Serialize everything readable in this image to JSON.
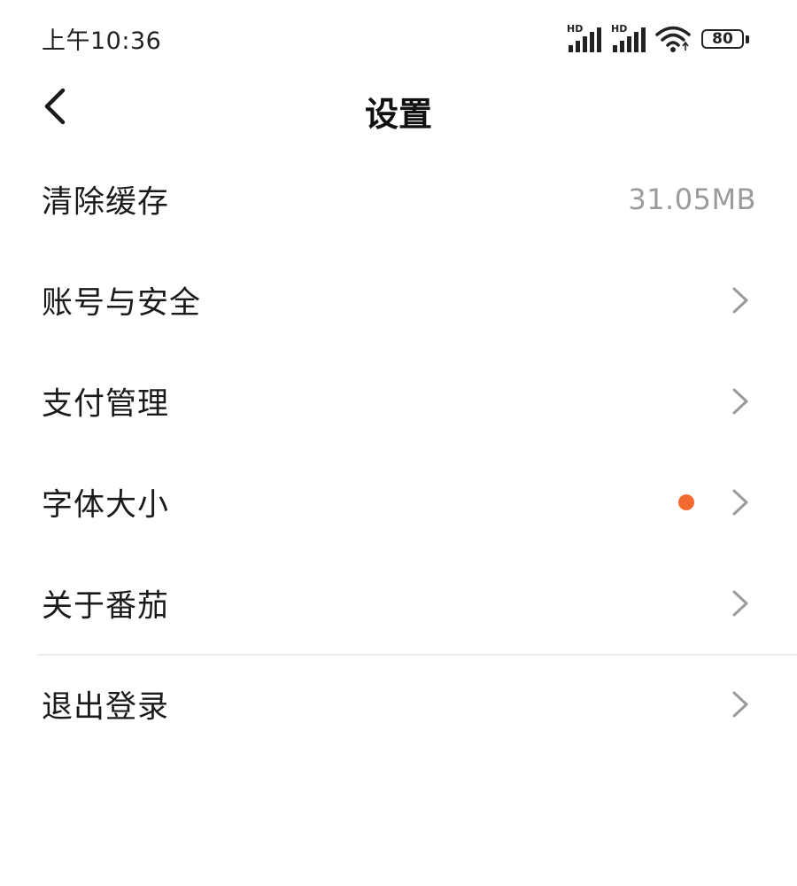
{
  "status_bar": {
    "time": "上午10:36",
    "signal_1_label": "HD",
    "signal_2_label": "HD",
    "battery_level": "80",
    "icons": [
      "signal-icon",
      "signal-icon",
      "wifi-icon",
      "battery-icon"
    ]
  },
  "nav": {
    "title": "设置",
    "back_icon": "chevron-left-icon"
  },
  "settings": {
    "items": [
      {
        "label": "清除缓存",
        "value": "31.05MB"
      },
      {
        "label": "账号与安全"
      },
      {
        "label": "支付管理"
      },
      {
        "label": "字体大小",
        "badge": "dot"
      },
      {
        "label": "关于番茄"
      },
      {
        "label": "退出登录"
      }
    ]
  },
  "colors": {
    "text_primary": "#1a1a1a",
    "text_secondary": "#9b9b9b",
    "chevron": "#9a9a9a",
    "badge_dot": "#f26a30",
    "divider": "#ececec"
  }
}
